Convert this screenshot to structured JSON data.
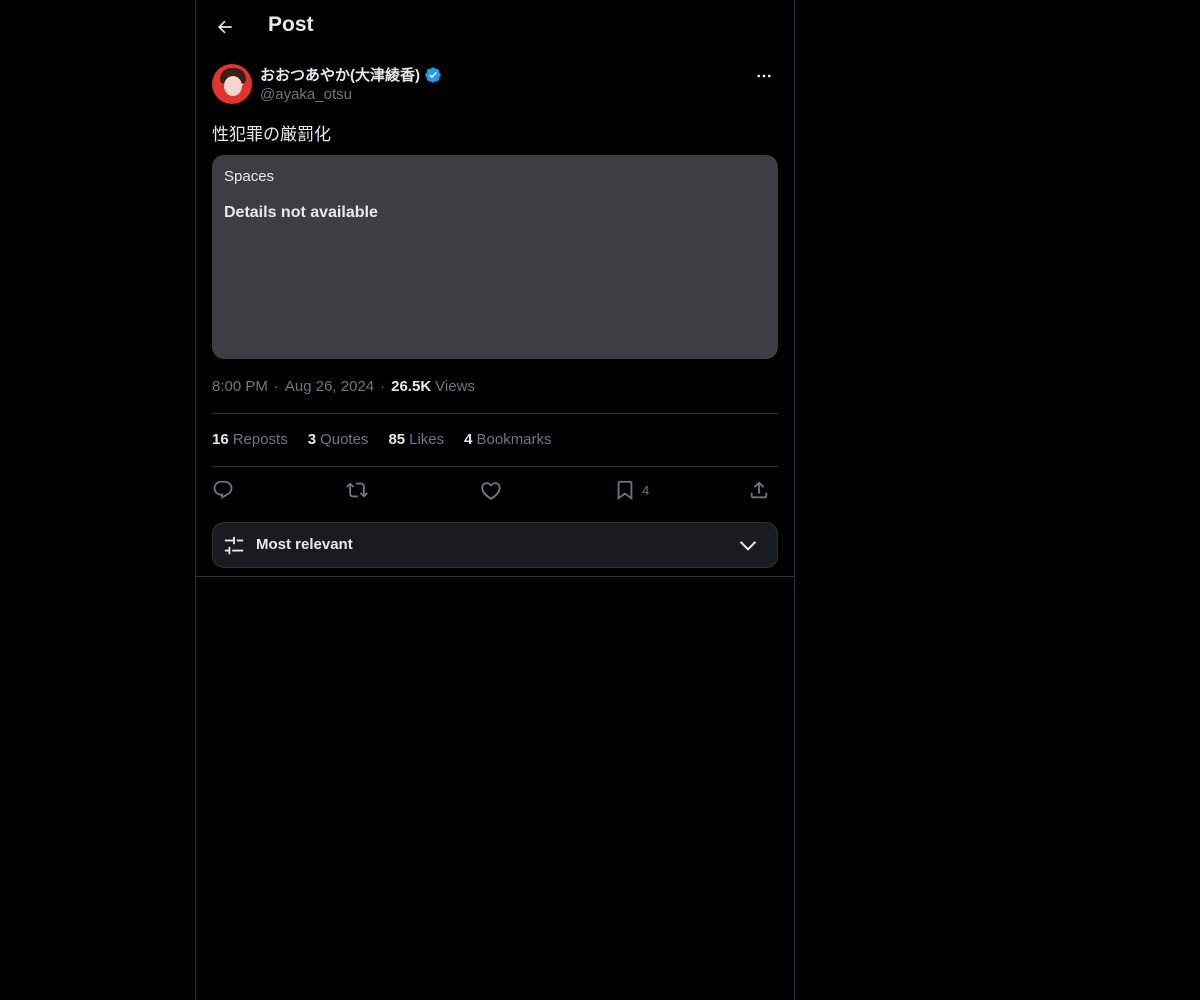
{
  "header": {
    "title": "Post",
    "back_icon": "arrow-left-icon"
  },
  "post": {
    "author": {
      "display_name": "おおつあやか(大津綾香)",
      "handle": "@ayaka_otsu",
      "verified": true,
      "verified_color": "#1d9bf0"
    },
    "text": "性犯罪の厳罰化",
    "card": {
      "label": "Spaces",
      "detail": "Details not available"
    },
    "meta": {
      "time": "8:00 PM",
      "separator": "·",
      "date": "Aug 26, 2024",
      "views_count": "26.5K",
      "views_label": "Views"
    },
    "stats": [
      {
        "count": "16",
        "label": "Reposts"
      },
      {
        "count": "3",
        "label": "Quotes"
      },
      {
        "count": "85",
        "label": "Likes"
      },
      {
        "count": "4",
        "label": "Bookmarks"
      }
    ],
    "actions": {
      "reply_icon": "reply-icon",
      "repost_icon": "repost-icon",
      "like_icon": "heart-icon",
      "bookmark_icon": "bookmark-icon",
      "bookmark_count": "4",
      "share_icon": "share-icon"
    }
  },
  "replies": {
    "sort_label": "Most relevant",
    "sort_icon": "sliders-icon",
    "dropdown_icon": "chevron-down-icon"
  },
  "colors": {
    "background": "#000000",
    "text": "#e7e9ea",
    "muted": "#71767b",
    "card": "#3e3d42",
    "border": "#2f3336"
  }
}
